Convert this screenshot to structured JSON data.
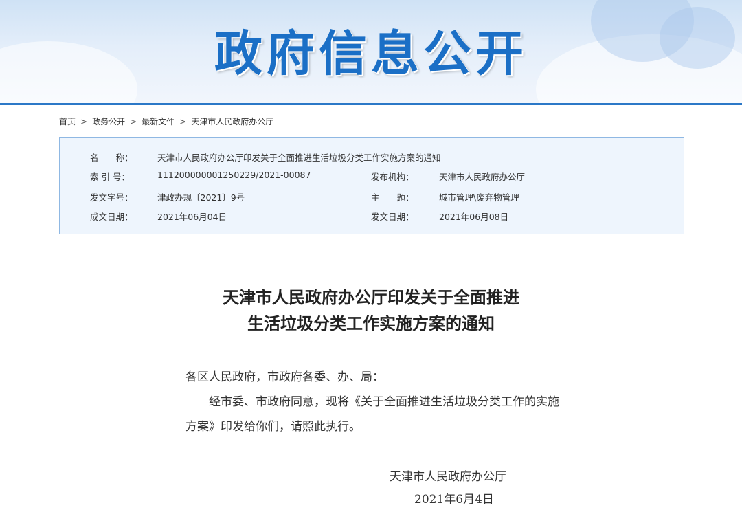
{
  "banner": {
    "title": "政府信息公开"
  },
  "breadcrumb": {
    "items": [
      "首页",
      "政务公开",
      "最新文件",
      "天津市人民政府办公厅"
    ],
    "separator": ">"
  },
  "info": {
    "name_label": "名　　称：",
    "name_value": "天津市人民政府办公厅印发关于全面推进生活垃圾分类工作实施方案的通知",
    "index_label": "索 引 号：",
    "index_value": "111200000001250229/2021-00087",
    "issuer_label": "发布机构：",
    "issuer_value": "天津市人民政府办公厅",
    "docno_label": "发文字号：",
    "docno_value": "津政办规〔2021〕9号",
    "topic_label": "主　　题：",
    "topic_value": "城市管理\\废弃物管理",
    "made_label": "成文日期：",
    "made_value": "2021年06月04日",
    "pub_label": "发文日期：",
    "pub_value": "2021年06月08日"
  },
  "document": {
    "title_line1": "天津市人民政府办公厅印发关于全面推进",
    "title_line2": "生活垃圾分类工作实施方案的通知",
    "salutation": "各区人民政府，市政府各委、办、局：",
    "body": "经市委、市政府同意，现将《关于全面推进生活垃圾分类工作的实施方案》印发给你们，请照此执行。",
    "signature": "天津市人民政府办公厅",
    "date": "2021年6月4日"
  },
  "colors": {
    "brand_blue": "#1b6fc6",
    "border_blue": "#8fb8e3",
    "box_bg": "#eef5fd"
  }
}
